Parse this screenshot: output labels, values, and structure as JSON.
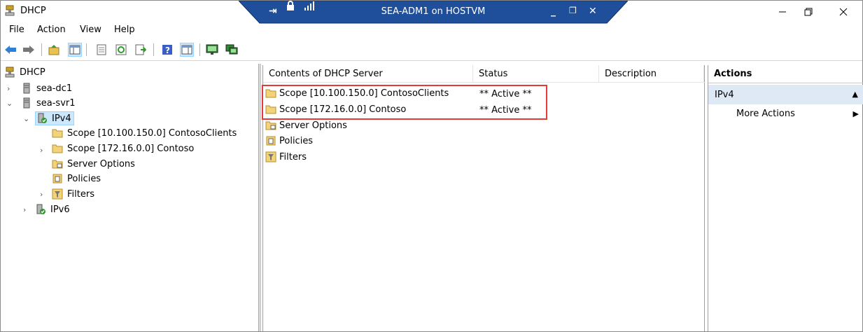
{
  "window": {
    "title": "DHCP"
  },
  "remote_bar": {
    "title": "SEA-ADM1 on HOSTVM"
  },
  "menu": [
    "File",
    "Action",
    "View",
    "Help"
  ],
  "tree": {
    "root": "DHCP",
    "servers": [
      {
        "name": "sea-dc1"
      },
      {
        "name": "sea-svr1"
      }
    ],
    "ipv4": "IPv4",
    "ipv4_children": [
      "Scope [10.100.150.0] ContosoClients",
      "Scope [172.16.0.0] Contoso",
      "Server Options",
      "Policies",
      "Filters"
    ],
    "ipv6": "IPv6"
  },
  "list": {
    "columns": [
      "Contents of DHCP Server",
      "Status",
      "Description"
    ],
    "rows": [
      {
        "name": "Scope [10.100.150.0] ContosoClients",
        "status": "** Active **"
      },
      {
        "name": "Scope [172.16.0.0] Contoso",
        "status": "** Active **"
      },
      {
        "name": "Server Options",
        "status": ""
      },
      {
        "name": "Policies",
        "status": ""
      },
      {
        "name": "Filters",
        "status": ""
      }
    ]
  },
  "actions": {
    "header": "Actions",
    "section": "IPv4",
    "items": [
      "More Actions"
    ]
  },
  "colors": {
    "highlight_border": "#e03c3c",
    "selection": "#cce8ff",
    "actions_section_bg": "#dfe8f5",
    "rdbar_bg": "#1f4f9a"
  }
}
